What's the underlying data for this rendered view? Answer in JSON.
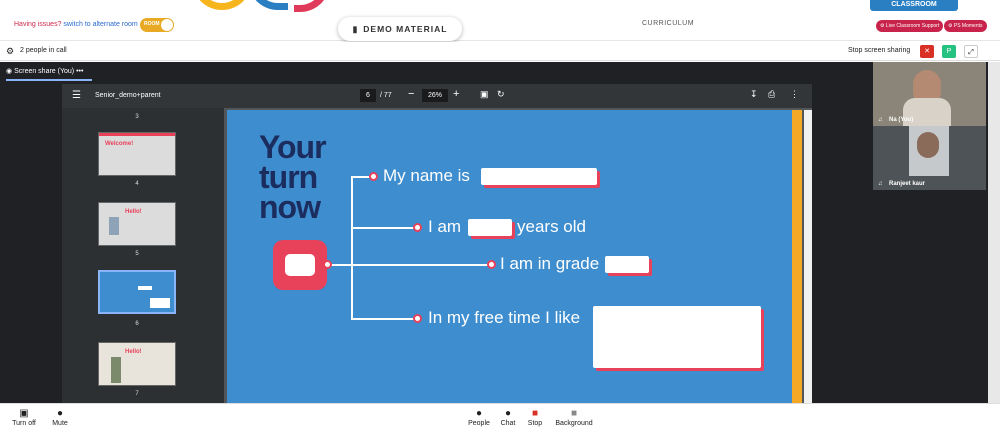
{
  "topbar": {
    "issues_text": "Having issues?",
    "switch_text": "switch to alternate room",
    "toggle_label": "ROOM",
    "demo_button": "DEMO MATERIAL",
    "curriculum": "CURRICULUM",
    "classroom_tab": "CLASSROOM",
    "live_support": "Live Classroom Support",
    "ps_moments": "PS Moments"
  },
  "meetbar": {
    "people_count": "2 people in call",
    "stop_sharing": "Stop screen sharing",
    "presenter_badge": "P"
  },
  "share": {
    "tab_label": "Screen share (You)",
    "more_dots": "•••"
  },
  "pdf": {
    "filename": "Senior_demo+parent",
    "page_current": "6",
    "page_total": "/ 77",
    "zoom": "26%",
    "thumbnails": [
      {
        "label": "3"
      },
      {
        "label": "4",
        "title": "Welcome!"
      },
      {
        "label": "5",
        "title": "Hello!"
      },
      {
        "label": "6"
      },
      {
        "label": "7",
        "title": "Hello!"
      }
    ]
  },
  "slide": {
    "title_line1": "Your",
    "title_line2": "turn",
    "title_line3": "now",
    "line1": "My name is",
    "line2a": "I am",
    "line2b": "years old",
    "line3": "I am in grade",
    "line4": "In my free time I like"
  },
  "participants": [
    {
      "name": "Na (You)"
    },
    {
      "name": "Ranjeet kaur"
    }
  ],
  "controls": {
    "camera": "Turn off",
    "mic": "Mute",
    "people": "People",
    "chat": "Chat",
    "stop": "Stop",
    "background": "Background"
  },
  "colors": {
    "slide_bg": "#3e8dce",
    "accent_red": "#e8415a",
    "title_navy": "#1b2c5e",
    "brand_blue": "#2a7fc3"
  }
}
